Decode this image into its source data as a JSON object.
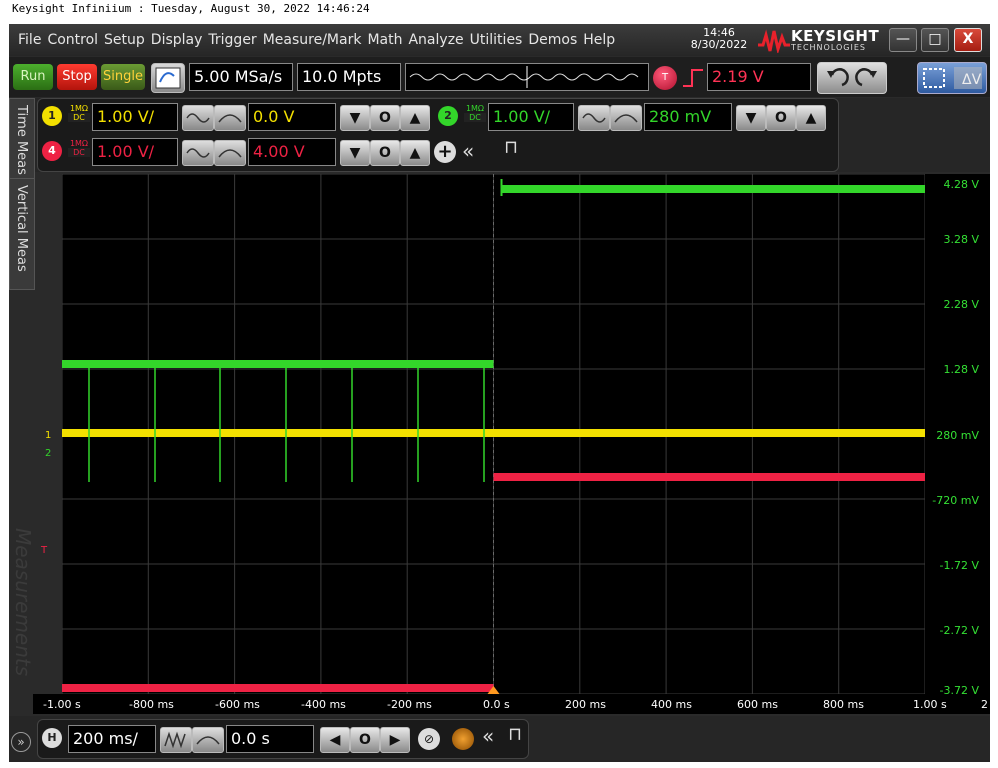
{
  "window_caption": "Keysight Infiniium : Tuesday, August 30, 2022 14:46:24",
  "menu": [
    "File",
    "Control",
    "Setup",
    "Display",
    "Trigger",
    "Measure/Mark",
    "Math",
    "Analyze",
    "Utilities",
    "Demos",
    "Help"
  ],
  "clock": {
    "time": "14:46",
    "date": "8/30/2022"
  },
  "brand": {
    "name": "KEYSIGHT",
    "sub": "TECHNOLOGIES",
    "accent": "#e8212b"
  },
  "window_buttons": {
    "minimize": "—",
    "maximize": "□",
    "close": "X"
  },
  "toolbar": {
    "run": "Run",
    "stop": "Stop",
    "single": "Single",
    "sample_rate": "5.00 MSa/s",
    "memory_depth": "10.0 Mpts",
    "trigger_label": "T",
    "trigger_level": "2.19 V"
  },
  "channels": [
    {
      "num": "1",
      "coupling_top": "1MΩ",
      "coupling_bottom": "DC",
      "scale": "1.00 V/",
      "offset": "0.0 V",
      "color": "#f3e000"
    },
    {
      "num": "2",
      "coupling_top": "1MΩ",
      "coupling_bottom": "DC",
      "scale": "1.00 V/",
      "offset": "280 mV",
      "color": "#33d62a"
    },
    {
      "num": "4",
      "coupling_top": "1MΩ",
      "coupling_bottom": "DC",
      "scale": "1.00 V/",
      "offset": "4.00 V",
      "color": "#ee2244"
    }
  ],
  "side_tabs": {
    "time": "Time Meas",
    "vertical": "Vertical Meas",
    "watermark": "Measurements"
  },
  "right_labels": [
    "4.28 V",
    "3.28 V",
    "2.28 V",
    "1.28 V",
    "280 mV",
    "-720 mV",
    "-1.72 V",
    "-2.72 V",
    "-3.72 V"
  ],
  "time_labels": [
    "-1.00 s",
    "-800 ms",
    "-600 ms",
    "-400 ms",
    "-200 ms",
    "0.0 s",
    "200 ms",
    "400 ms",
    "600 ms",
    "800 ms",
    "1.00 s"
  ],
  "axis_corner": "2",
  "markers": {
    "ch1": "1",
    "ch2": "2",
    "trigger": "T"
  },
  "horizontal": {
    "label": "H",
    "scale": "200 ms/",
    "position": "0.0 s"
  },
  "colors": {
    "ch1": "#f3e000",
    "ch2": "#33d62a",
    "ch4": "#ee2244",
    "grid": "#3a3a3a",
    "label": "#34e034"
  }
}
